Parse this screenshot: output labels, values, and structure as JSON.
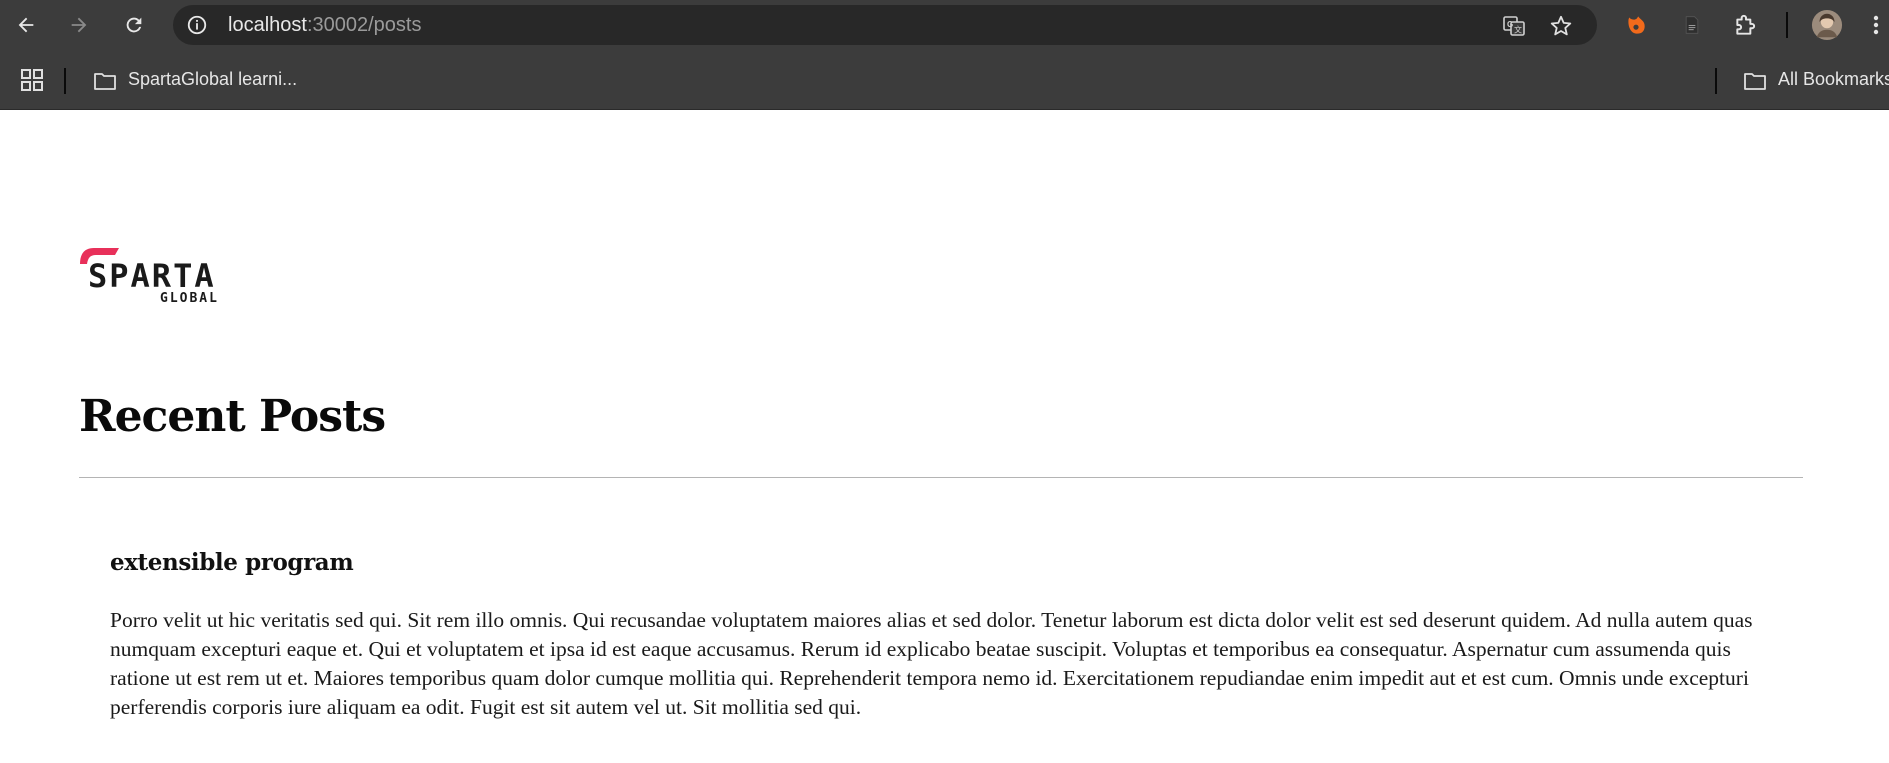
{
  "browser": {
    "url_host": "localhost",
    "url_path": ":30002/posts",
    "bookmark_folder": "SpartaGlobal learni...",
    "all_bookmarks": "All Bookmarks",
    "icons": [
      "back-icon",
      "forward-icon",
      "reload-icon",
      "site-info-icon",
      "translate-icon",
      "star-icon",
      "extension-icon",
      "document-icon",
      "puzzle-icon",
      "avatar",
      "more-menu-icon",
      "apps-grid-icon",
      "folder-icon"
    ]
  },
  "logo": {
    "wordmark": "SPARTA",
    "subtitle": "GLOBAL",
    "accent_color": "#e8305a"
  },
  "page": {
    "title": "Recent Posts"
  },
  "posts": [
    {
      "title": "extensible program",
      "body": "Porro velit ut hic veritatis sed qui. Sit rem illo omnis. Qui recusandae voluptatem maiores alias et sed dolor. Tenetur laborum est dicta dolor velit est sed deserunt quidem. Ad nulla autem quas numquam excepturi eaque et. Qui et voluptatem et ipsa id est eaque accusamus. Rerum id explicabo beatae suscipit. Voluptas et temporibus ea consequatur. Aspernatur cum assumenda quis ratione ut est rem ut et. Maiores temporibus quam dolor cumque mollitia qui. Reprehenderit tempora nemo id. Exercitationem repudiandae enim impedit aut et est cum. Omnis unde excepturi perferendis corporis iure aliquam ea odit. Fugit est sit autem vel ut. Sit mollitia sed qui."
    }
  ]
}
